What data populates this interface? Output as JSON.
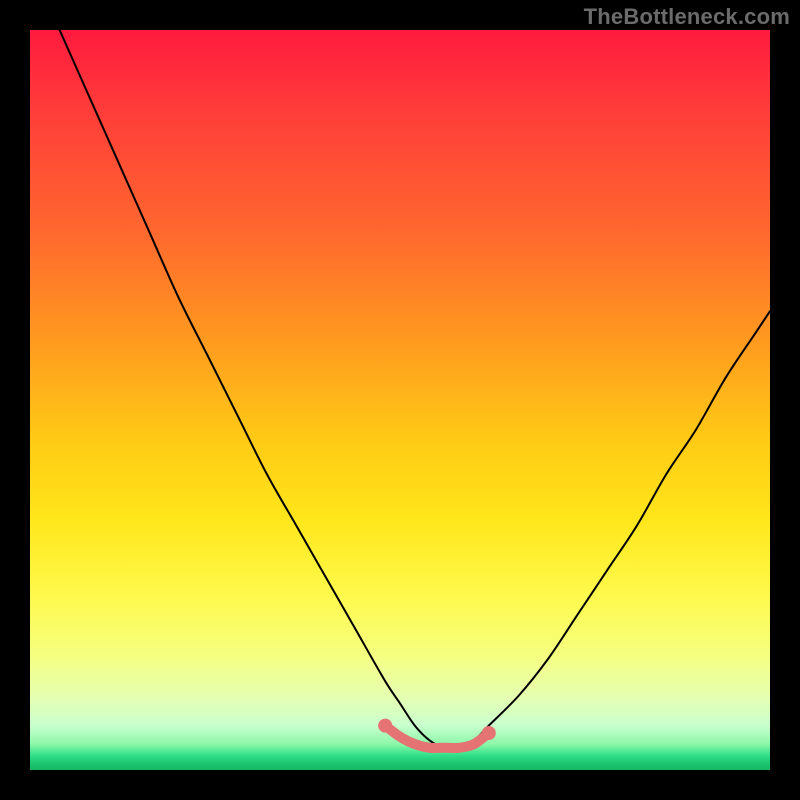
{
  "watermark": "TheBottleneck.com",
  "colors": {
    "black": "#000000",
    "gradient_top": "#ff1a3e",
    "gradient_bottom": "#17b765",
    "curve": "#000000",
    "marker": "#e57373"
  },
  "chart_data": {
    "type": "line",
    "title": "",
    "xlabel": "",
    "ylabel": "",
    "xlim": [
      0,
      100
    ],
    "ylim": [
      0,
      100
    ],
    "grid": false,
    "notes": "Bottleneck-style curve. No axis ticks or labels are rendered; x and y are normalized 0–100 based on plot-area pixels. The curve descends from top-left into a shallow trough near x≈52–60 (y≈3) then rises toward the right. A short salmon segment with two end dots marks the trough region.",
    "series": [
      {
        "name": "bottleneck-curve",
        "color": "#000000",
        "x": [
          4,
          8,
          12,
          16,
          20,
          24,
          28,
          32,
          36,
          40,
          44,
          48,
          50,
          52,
          54,
          56,
          58,
          60,
          62,
          66,
          70,
          74,
          78,
          82,
          86,
          90,
          94,
          98,
          100
        ],
        "y": [
          100,
          91,
          82,
          73,
          64,
          56,
          48,
          40,
          33,
          26,
          19,
          12,
          9,
          6,
          4,
          3,
          3,
          4,
          6,
          10,
          15,
          21,
          27,
          33,
          40,
          46,
          53,
          59,
          62
        ]
      },
      {
        "name": "optimal-range-marker",
        "color": "#e57373",
        "x": [
          48,
          50,
          52,
          54,
          56,
          58,
          60,
          62
        ],
        "y": [
          6,
          4.5,
          3.5,
          3,
          3,
          3,
          3.5,
          5
        ]
      }
    ],
    "annotations": [
      {
        "type": "dot",
        "x": 48,
        "y": 6,
        "color": "#e57373"
      },
      {
        "type": "dot",
        "x": 62,
        "y": 5,
        "color": "#e57373"
      }
    ]
  }
}
